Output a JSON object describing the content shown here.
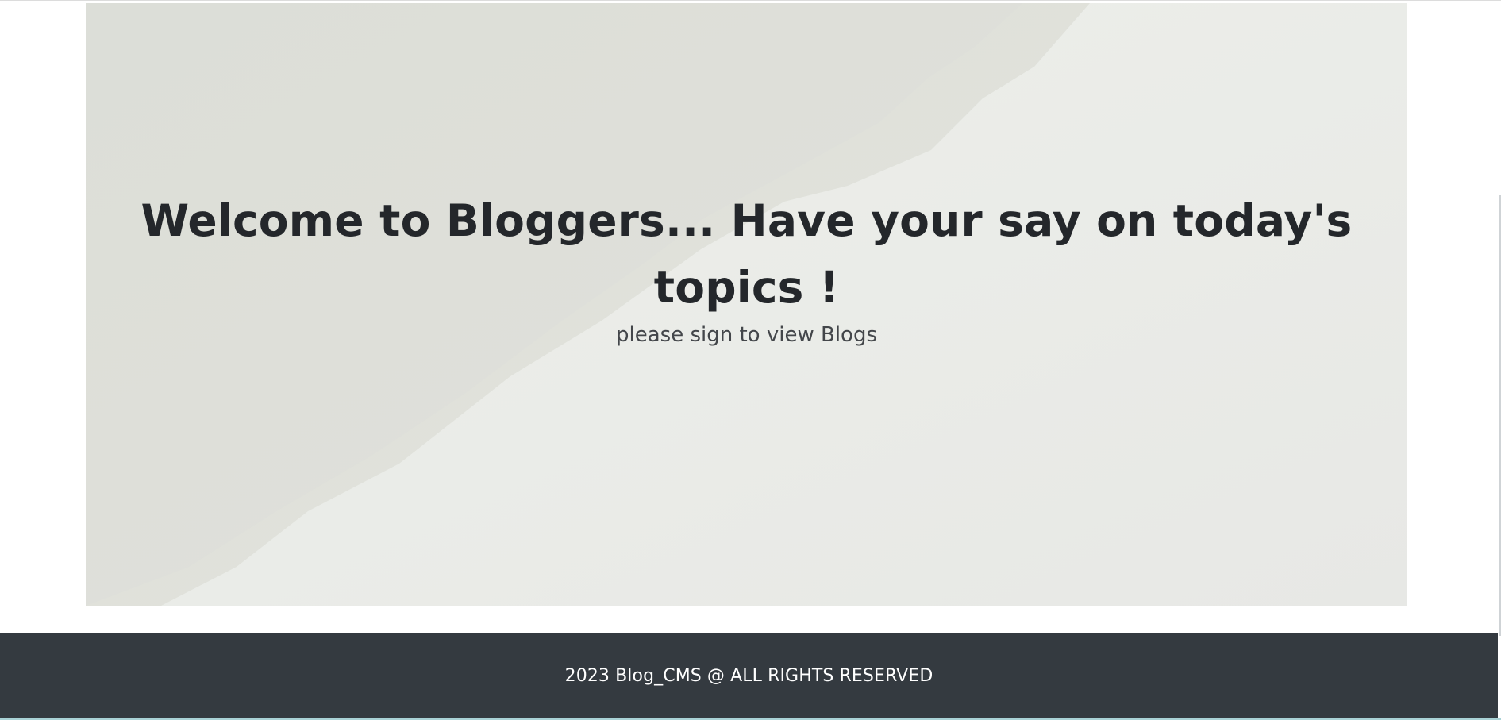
{
  "hero": {
    "title": "Welcome to Bloggers... Have your say on today's topics !",
    "subtitle": "please sign to view Blogs"
  },
  "footer": {
    "text": "2023 Blog_CMS @ ALL RIGHTS RESERVED"
  },
  "colors": {
    "hero_background": "#e9eae6",
    "footer_background": "#343a40",
    "footer_text": "#ffffff",
    "title_text": "#24272b"
  }
}
